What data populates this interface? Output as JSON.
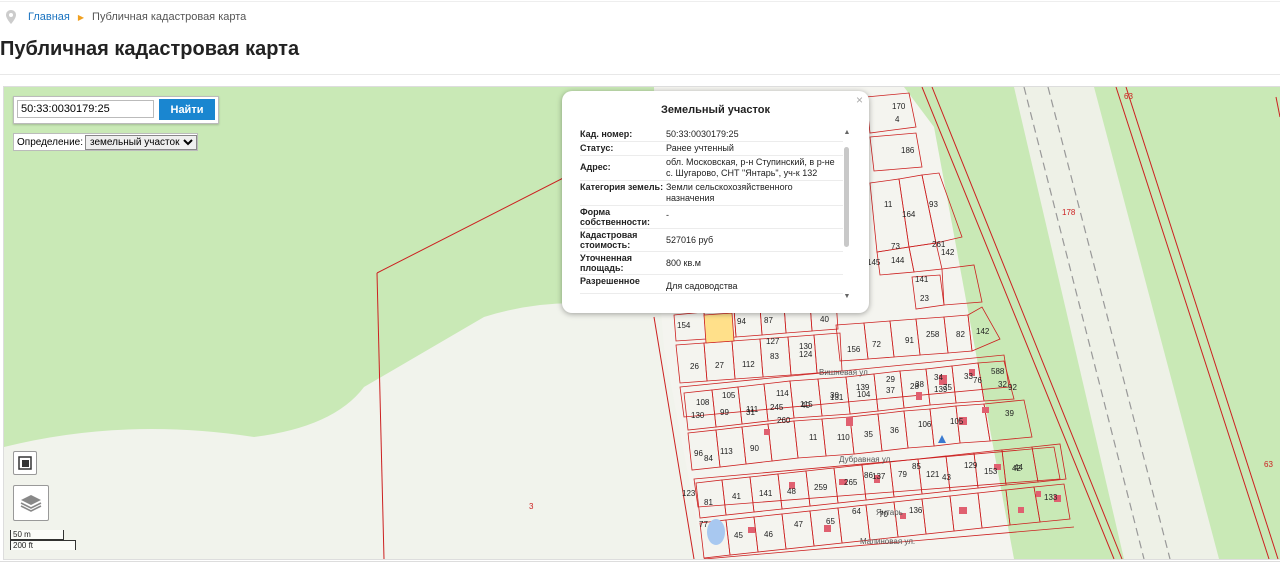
{
  "breadcrumb": {
    "home": "Главная",
    "current": "Публичная кадастровая карта"
  },
  "page": {
    "title": "Публичная кадастровая карта"
  },
  "search": {
    "value": "50:33:0030179:25",
    "button": "Найти"
  },
  "definition": {
    "label": "Определение:",
    "selected": "земельный участок"
  },
  "scale": {
    "metric": "50 m",
    "imperial": "200 ft"
  },
  "popup": {
    "title": "Земельный участок",
    "close": "×",
    "rows": [
      {
        "key": "Кад. номер:",
        "value": "50:33:0030179:25"
      },
      {
        "key": "Статус:",
        "value": "Ранее учтенный"
      },
      {
        "key": "Адрес:",
        "value": "обл. Московская, р-н Ступинский, в р-не с. Шугарово, СНТ \"Янтарь\", уч-к 132"
      },
      {
        "key": "Категория земель:",
        "value": "Земли сельскохозяйственного назначения"
      },
      {
        "key": "Форма собственности:",
        "value": "-"
      },
      {
        "key": "Кадастровая стоимость:",
        "value": "527016 руб"
      },
      {
        "key": "Уточненная площадь:",
        "value": "800 кв.м"
      },
      {
        "key": "Разрешенное",
        "value": "Для садоводства"
      }
    ]
  },
  "map": {
    "streets": [
      "Вишневая ул.",
      "Дубравная ул.",
      "Янтарь",
      "Малиновая ул."
    ],
    "boundary_labels": [
      "178",
      "63",
      "63",
      "3"
    ],
    "plot_numbers": [
      "170",
      "4",
      "186",
      "11",
      "164",
      "93",
      "73",
      "144",
      "261",
      "142",
      "145",
      "141",
      "23",
      "154",
      "94",
      "87",
      "40",
      "258",
      "82",
      "142",
      "127",
      "124",
      "156",
      "72",
      "91",
      "26",
      "27",
      "112",
      "83",
      "130",
      "139",
      "108",
      "105",
      "111",
      "114",
      "115",
      "30",
      "139",
      "29",
      "28",
      "34",
      "33",
      "588",
      "32",
      "130",
      "99",
      "31",
      "245",
      "40",
      "131",
      "104",
      "37",
      "38",
      "75",
      "76",
      "39",
      "260",
      "11",
      "110",
      "35",
      "36",
      "106",
      "105",
      "92",
      "96",
      "113",
      "90",
      "84",
      "86",
      "85",
      "43",
      "153",
      "42",
      "123",
      "81",
      "41",
      "141",
      "48",
      "259",
      "265",
      "137",
      "79",
      "121",
      "129",
      "44",
      "133",
      "77",
      "45",
      "46",
      "47",
      "65",
      "64",
      "70",
      "136"
    ]
  },
  "colors": {
    "accent": "#1a86d0",
    "boundary": "#cc2020",
    "green": "#c8e8b4",
    "selected_plot": "#ffe08a"
  }
}
